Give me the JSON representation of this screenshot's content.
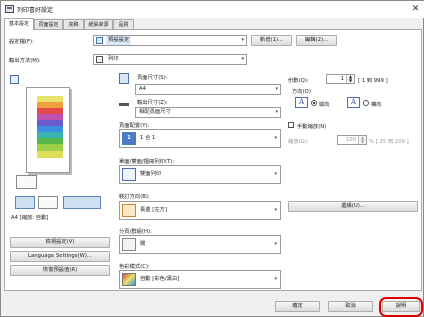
{
  "window": {
    "title": "列印喜好設定",
    "close_glyph": "✕"
  },
  "tabs": [
    {
      "label": "基本設定"
    },
    {
      "label": "頁面設定"
    },
    {
      "label": "完稿"
    },
    {
      "label": "紙張來源"
    },
    {
      "label": "品質"
    }
  ],
  "profile": {
    "label": "設定檔(F):",
    "value": "預設設定",
    "add_button": "新增(1)...",
    "edit_button": "編輯(2)..."
  },
  "output_method": {
    "label": "輸出方法(M):",
    "value": "列印"
  },
  "page_size": {
    "label": "頁面尺寸(S):",
    "value": "A4"
  },
  "output_size": {
    "label": "輸出尺寸(Z):",
    "value": "相配頁面尺寸"
  },
  "copies": {
    "label": "份數(Q):",
    "value": "1",
    "range": "[ 1 到 999 ]"
  },
  "orientation": {
    "label": "方向(O)",
    "portrait": {
      "label": "縱向",
      "glyph": "A"
    },
    "landscape": {
      "label": "橫向",
      "glyph": "A"
    }
  },
  "page_layout": {
    "label": "頁面配置(Y):",
    "value": "1 合 1",
    "badge": "1"
  },
  "manual_scaling": {
    "label": "手動縮放(N)",
    "scale_label": "縮放(G):",
    "scale_value": "100",
    "scale_range": "% [ 25 到 200 ]"
  },
  "duplex": {
    "label": "單面/雙面/摺冊列印(T):",
    "value": "雙面列印"
  },
  "binding": {
    "label": "裝訂方向(B):",
    "value": "長邊 [左方]",
    "margin_button": "邊緣(U)..."
  },
  "collate": {
    "label": "分頁/群組(H):",
    "value": "關"
  },
  "color_mode": {
    "label": "色彩模式(C):",
    "value": "自動 [彩色/黑白]"
  },
  "preview": {
    "caption": "A4 [縮放: 自動]"
  },
  "side_buttons": {
    "view_settings": "檢視設定(V)",
    "language": "Language Settings(W)...",
    "restore": "恢復預設值(R)"
  },
  "footer": {
    "ok": "確定",
    "cancel": "取消",
    "help": "說明"
  },
  "colors": {
    "highlight": "#d00000",
    "accent": "#2b4f8f"
  }
}
